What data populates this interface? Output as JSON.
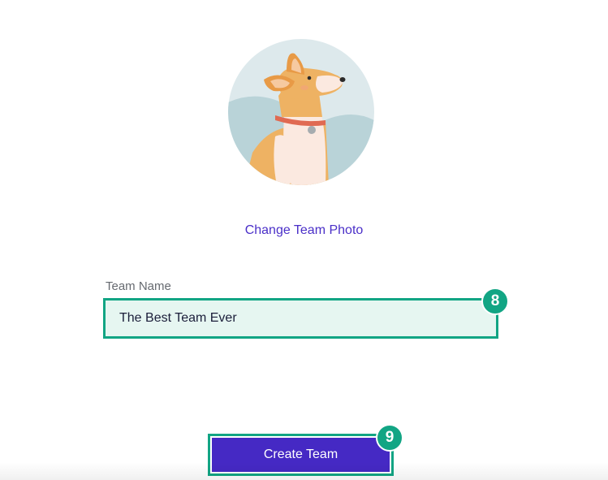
{
  "team_photo": {
    "change_label": "Change Team Photo",
    "image_subject": "corgi-illustration"
  },
  "team_name": {
    "label": "Team Name",
    "value": "The Best Team Ever",
    "marker": "8"
  },
  "create_button": {
    "label": "Create Team",
    "marker": "9"
  },
  "colors": {
    "accent_green": "#12a584",
    "primary_purple": "#4529c4",
    "link_purple": "#4a2fc8",
    "input_bg": "#e6f6f1"
  }
}
